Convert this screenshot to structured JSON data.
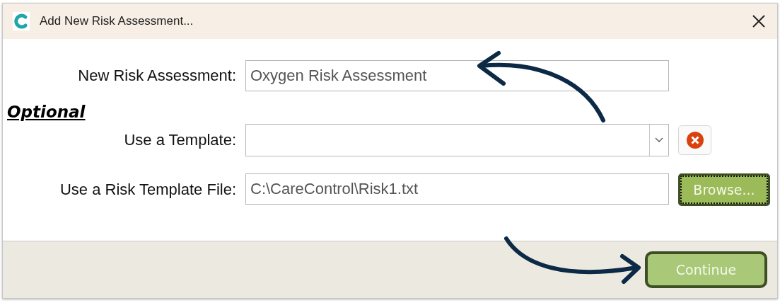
{
  "window": {
    "title": "Add New Risk Assessment..."
  },
  "form": {
    "name_field": {
      "label": "New Risk Assessment:",
      "value": "Oxygen Risk Assessment"
    },
    "section_heading": "Optional",
    "template_field": {
      "label": "Use a Template:"
    },
    "file_field": {
      "label": "Use a Risk Template File:",
      "value": "C:\\CareControl\\Risk1.txt"
    },
    "browse_button": {
      "label": "Browse...",
      "focused": true
    }
  },
  "footer": {
    "continue_button": "Continue"
  }
}
